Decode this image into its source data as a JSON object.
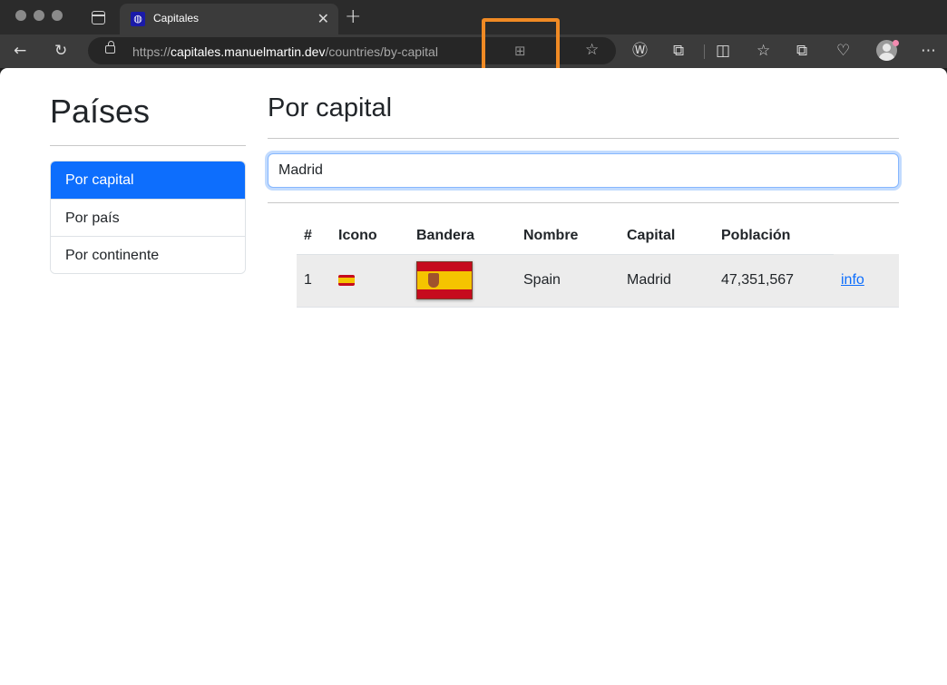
{
  "browser": {
    "tab_title": "Capitales",
    "url_scheme": "https://",
    "url_host": "capitales.manuelmartin.dev",
    "url_path": "/countries/by-capital"
  },
  "sidebar": {
    "title": "Países",
    "items": [
      {
        "label": "Por capital",
        "active": true
      },
      {
        "label": "Por país",
        "active": false
      },
      {
        "label": "Por continente",
        "active": false
      }
    ]
  },
  "main": {
    "title": "Por capital",
    "search_value": "Madrid"
  },
  "table": {
    "headers": [
      "#",
      "Icono",
      "Bandera",
      "Nombre",
      "Capital",
      "Población"
    ],
    "rows": [
      {
        "index": "1",
        "icon": "flag-es-icon",
        "flag": "flag-spain",
        "name": "Spain",
        "capital": "Madrid",
        "population": "47,351,567",
        "link": "info"
      }
    ]
  },
  "colors": {
    "accent": "#0d6efd",
    "highlight": "#f08a24"
  }
}
